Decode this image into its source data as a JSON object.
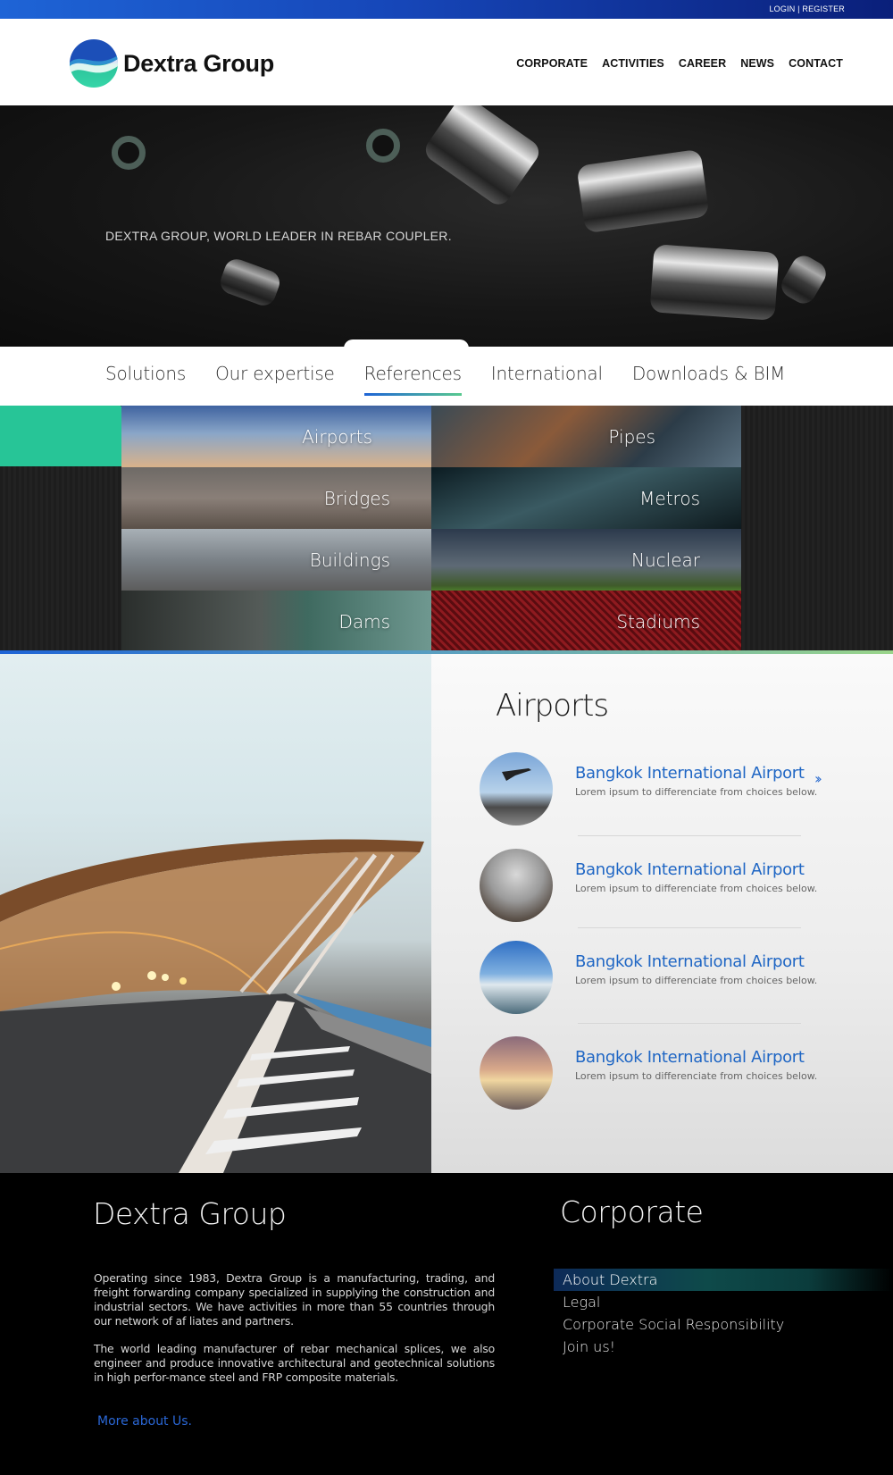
{
  "topbar": {
    "login_register": "LOGIN | REGISTER"
  },
  "header": {
    "logo_text": "Dextra Group",
    "nav": [
      "CORPORATE",
      "ACTIVITIES",
      "CAREER",
      "NEWS",
      "CONTACT"
    ]
  },
  "hero": {
    "tagline": "DEXTRA GROUP, WORLD LEADER IN REBAR COUPLER."
  },
  "tabs": {
    "items": [
      "Solutions",
      "Our expertise",
      "References",
      "International",
      "Downloads & BIM"
    ],
    "active": "References"
  },
  "categories": [
    "Airports",
    "Pipes",
    "Bridges",
    "Metros",
    "Buildings",
    "Nuclear",
    "Dams",
    "Stadiums"
  ],
  "airports": {
    "heading": "Airports",
    "refs": [
      {
        "title": "Bangkok International Airport",
        "desc": "Lorem ipsum to differenciate from choices below."
      },
      {
        "title": "Bangkok International Airport",
        "desc": "Lorem ipsum to differenciate from choices below."
      },
      {
        "title": "Bangkok International Airport",
        "desc": "Lorem ipsum to differenciate from choices below."
      },
      {
        "title": "Bangkok International Airport",
        "desc": "Lorem ipsum to differenciate from choices below."
      }
    ]
  },
  "footer": {
    "left_heading": "Dextra Group",
    "para1": "Operating since 1983, Dextra Group is a manufacturing, trading, and freight forwarding company specialized in supplying the construction and industrial sectors. We have activities in more than 55 countries through our network of af liates and partners.",
    "para2": "The world leading manufacturer of rebar mechanical splices, we also engineer and produce innovative architectural and geotechnical solutions in high perfor-mance steel and FRP composite materials.",
    "more_link": "More about Us.",
    "right_heading": "Corporate",
    "corporate_links": [
      "About Dextra",
      "Legal",
      "Corporate Social Responsibility",
      "Join us!"
    ]
  },
  "colors": {
    "brand_blue": "#1f66c4",
    "accent_green": "#27c597",
    "footer_bg": "#000000"
  }
}
